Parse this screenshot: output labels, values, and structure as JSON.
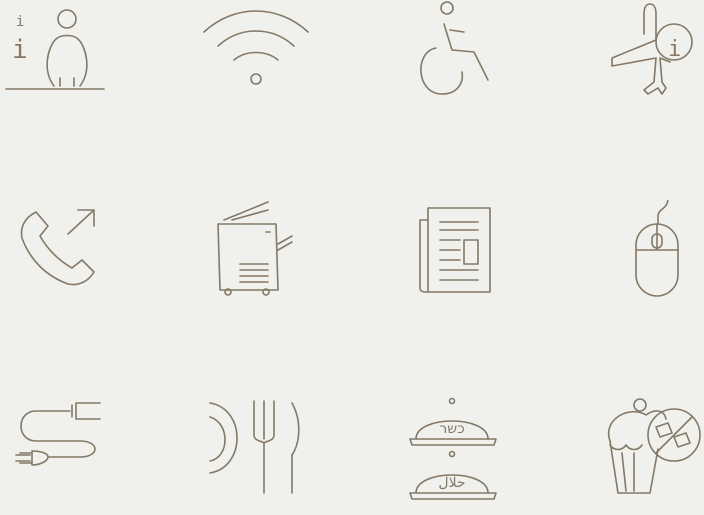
{
  "theme": {
    "background": "#f0f0ec",
    "stroke": "#857866"
  },
  "icons": [
    {
      "name": "information-desk-icon",
      "glyph": "i"
    },
    {
      "name": "wifi-icon"
    },
    {
      "name": "wheelchair-accessible-icon"
    },
    {
      "name": "flight-information-icon",
      "glyph": "i"
    },
    {
      "name": "phone-outgoing-call-icon"
    },
    {
      "name": "photocopier-icon"
    },
    {
      "name": "newspaper-icon"
    },
    {
      "name": "computer-mouse-icon"
    },
    {
      "name": "power-plug-icon"
    },
    {
      "name": "restaurant-icon"
    },
    {
      "name": "kosher-halal-meal-icon",
      "kosher_text": "כשר",
      "halal_text": "حلال"
    },
    {
      "name": "sugar-free-dessert-icon"
    }
  ]
}
